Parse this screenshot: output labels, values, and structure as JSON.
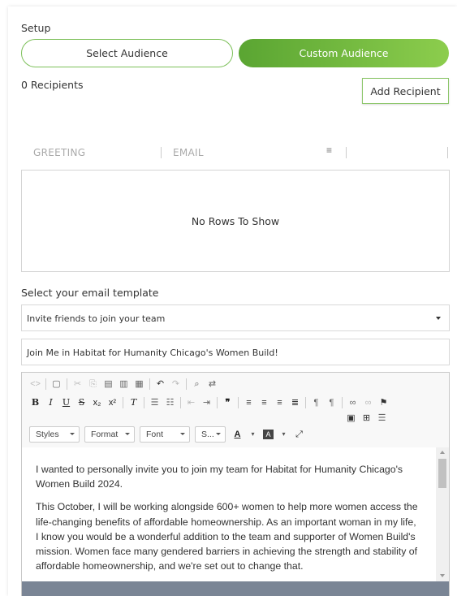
{
  "setup": {
    "title": "Setup",
    "audience_options": [
      "Select Audience",
      "Custom Audience"
    ],
    "selected_audience": "Custom Audience"
  },
  "recipients": {
    "count_label": "0 Recipients",
    "add_button": "Add Recipient"
  },
  "grid": {
    "columns": [
      "GREETING",
      "EMAIL"
    ],
    "empty_message": "No Rows To Show"
  },
  "template": {
    "label": "Select your email template",
    "selected": "Invite friends to join your team"
  },
  "subject": {
    "value": "Join Me in Habitat for Humanity Chicago's Women Build!"
  },
  "editor": {
    "toolbar_combos": [
      "Styles",
      "Format",
      "Font",
      "S..."
    ],
    "paragraphs": [
      "I wanted to personally invite you to join my team for Habitat for Humanity Chicago's Women Build 2024.",
      "This October, I will be working alongside 600+ women to help more women access the life-changing benefits of affordable homeownership. As an important woman in my life, I know you would be a wonderful addition to the team and supporter of Women Build's mission. Women face many gendered barriers in achieving the strength and stability of affordable homeownership, and we're set out to change that."
    ]
  },
  "colors": {
    "accent_green": "#6db33f",
    "footer_bar": "#7a8595"
  }
}
